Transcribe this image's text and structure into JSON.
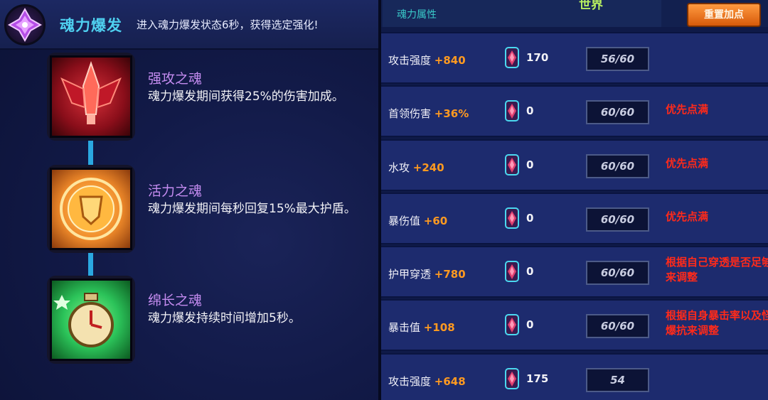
{
  "left": {
    "header": {
      "title": "魂力爆发",
      "description": "进入魂力爆发状态6秒，获得选定强化!"
    },
    "skills": [
      {
        "name": "强攻之魂",
        "description": "魂力爆发期间获得25%的伤害加成。",
        "icon": "red-spire-icon",
        "color": "#c8262e"
      },
      {
        "name": "活力之魂",
        "description": "魂力爆发期间每秒回复15%最大护盾。",
        "icon": "golden-shield-icon",
        "color": "#f08a2a"
      },
      {
        "name": "绵长之魂",
        "description": "魂力爆发持续时间增加5秒。",
        "icon": "green-timer-icon",
        "color": "#2cc45a"
      }
    ]
  },
  "right": {
    "tab_label": "魂力属性",
    "world_label": "世界",
    "reset_button": "重置加点",
    "rows": [
      {
        "name": "攻击强度",
        "bonus": "+840",
        "count": "170",
        "level": "56/60",
        "note": ""
      },
      {
        "name": "首领伤害",
        "bonus": "+36%",
        "count": "0",
        "level": "60/60",
        "note": "优先点满"
      },
      {
        "name": "水攻",
        "bonus": "+240",
        "count": "0",
        "level": "60/60",
        "note": "优先点满"
      },
      {
        "name": "暴伤值",
        "bonus": "+60",
        "count": "0",
        "level": "60/60",
        "note": "优先点满"
      },
      {
        "name": "护甲穿透",
        "bonus": "+780",
        "count": "0",
        "level": "60/60",
        "note": "根据自己穿透是否足够来调整"
      },
      {
        "name": "暴击值",
        "bonus": "+108",
        "count": "0",
        "level": "60/60",
        "note": "根据自身暴击率以及怪爆抗来调整"
      },
      {
        "name": "攻击强度",
        "bonus": "+648",
        "count": "175",
        "level": "54",
        "note": ""
      }
    ]
  },
  "colors": {
    "accent_cyan": "#4fd0f0",
    "bonus_orange": "#ff9a20",
    "note_red": "#ff2a1a",
    "skill_purple": "#c48cf0"
  }
}
